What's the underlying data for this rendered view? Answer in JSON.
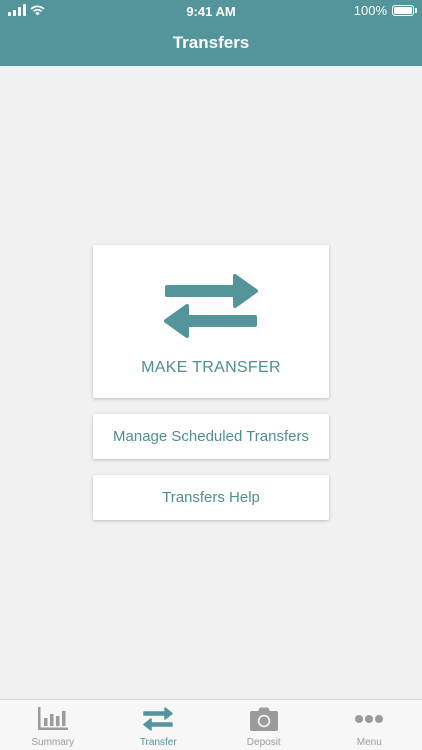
{
  "status_bar": {
    "time": "9:41 AM",
    "battery": "100%"
  },
  "header": {
    "title": "Transfers"
  },
  "cards": {
    "make_transfer": "MAKE TRANSFER",
    "manage_scheduled": "Manage Scheduled Transfers",
    "help": "Transfers Help"
  },
  "tabs": [
    {
      "label": "Summary",
      "icon": "bar-chart-icon",
      "active": false
    },
    {
      "label": "Transfer",
      "icon": "transfer-arrows-icon",
      "active": true
    },
    {
      "label": "Deposit",
      "icon": "camera-icon",
      "active": false
    },
    {
      "label": "Menu",
      "icon": "more-dots-icon",
      "active": false
    }
  ],
  "colors": {
    "accent": "#53959a",
    "background": "#f1f1f1",
    "inactive": "#9b9b9b"
  }
}
